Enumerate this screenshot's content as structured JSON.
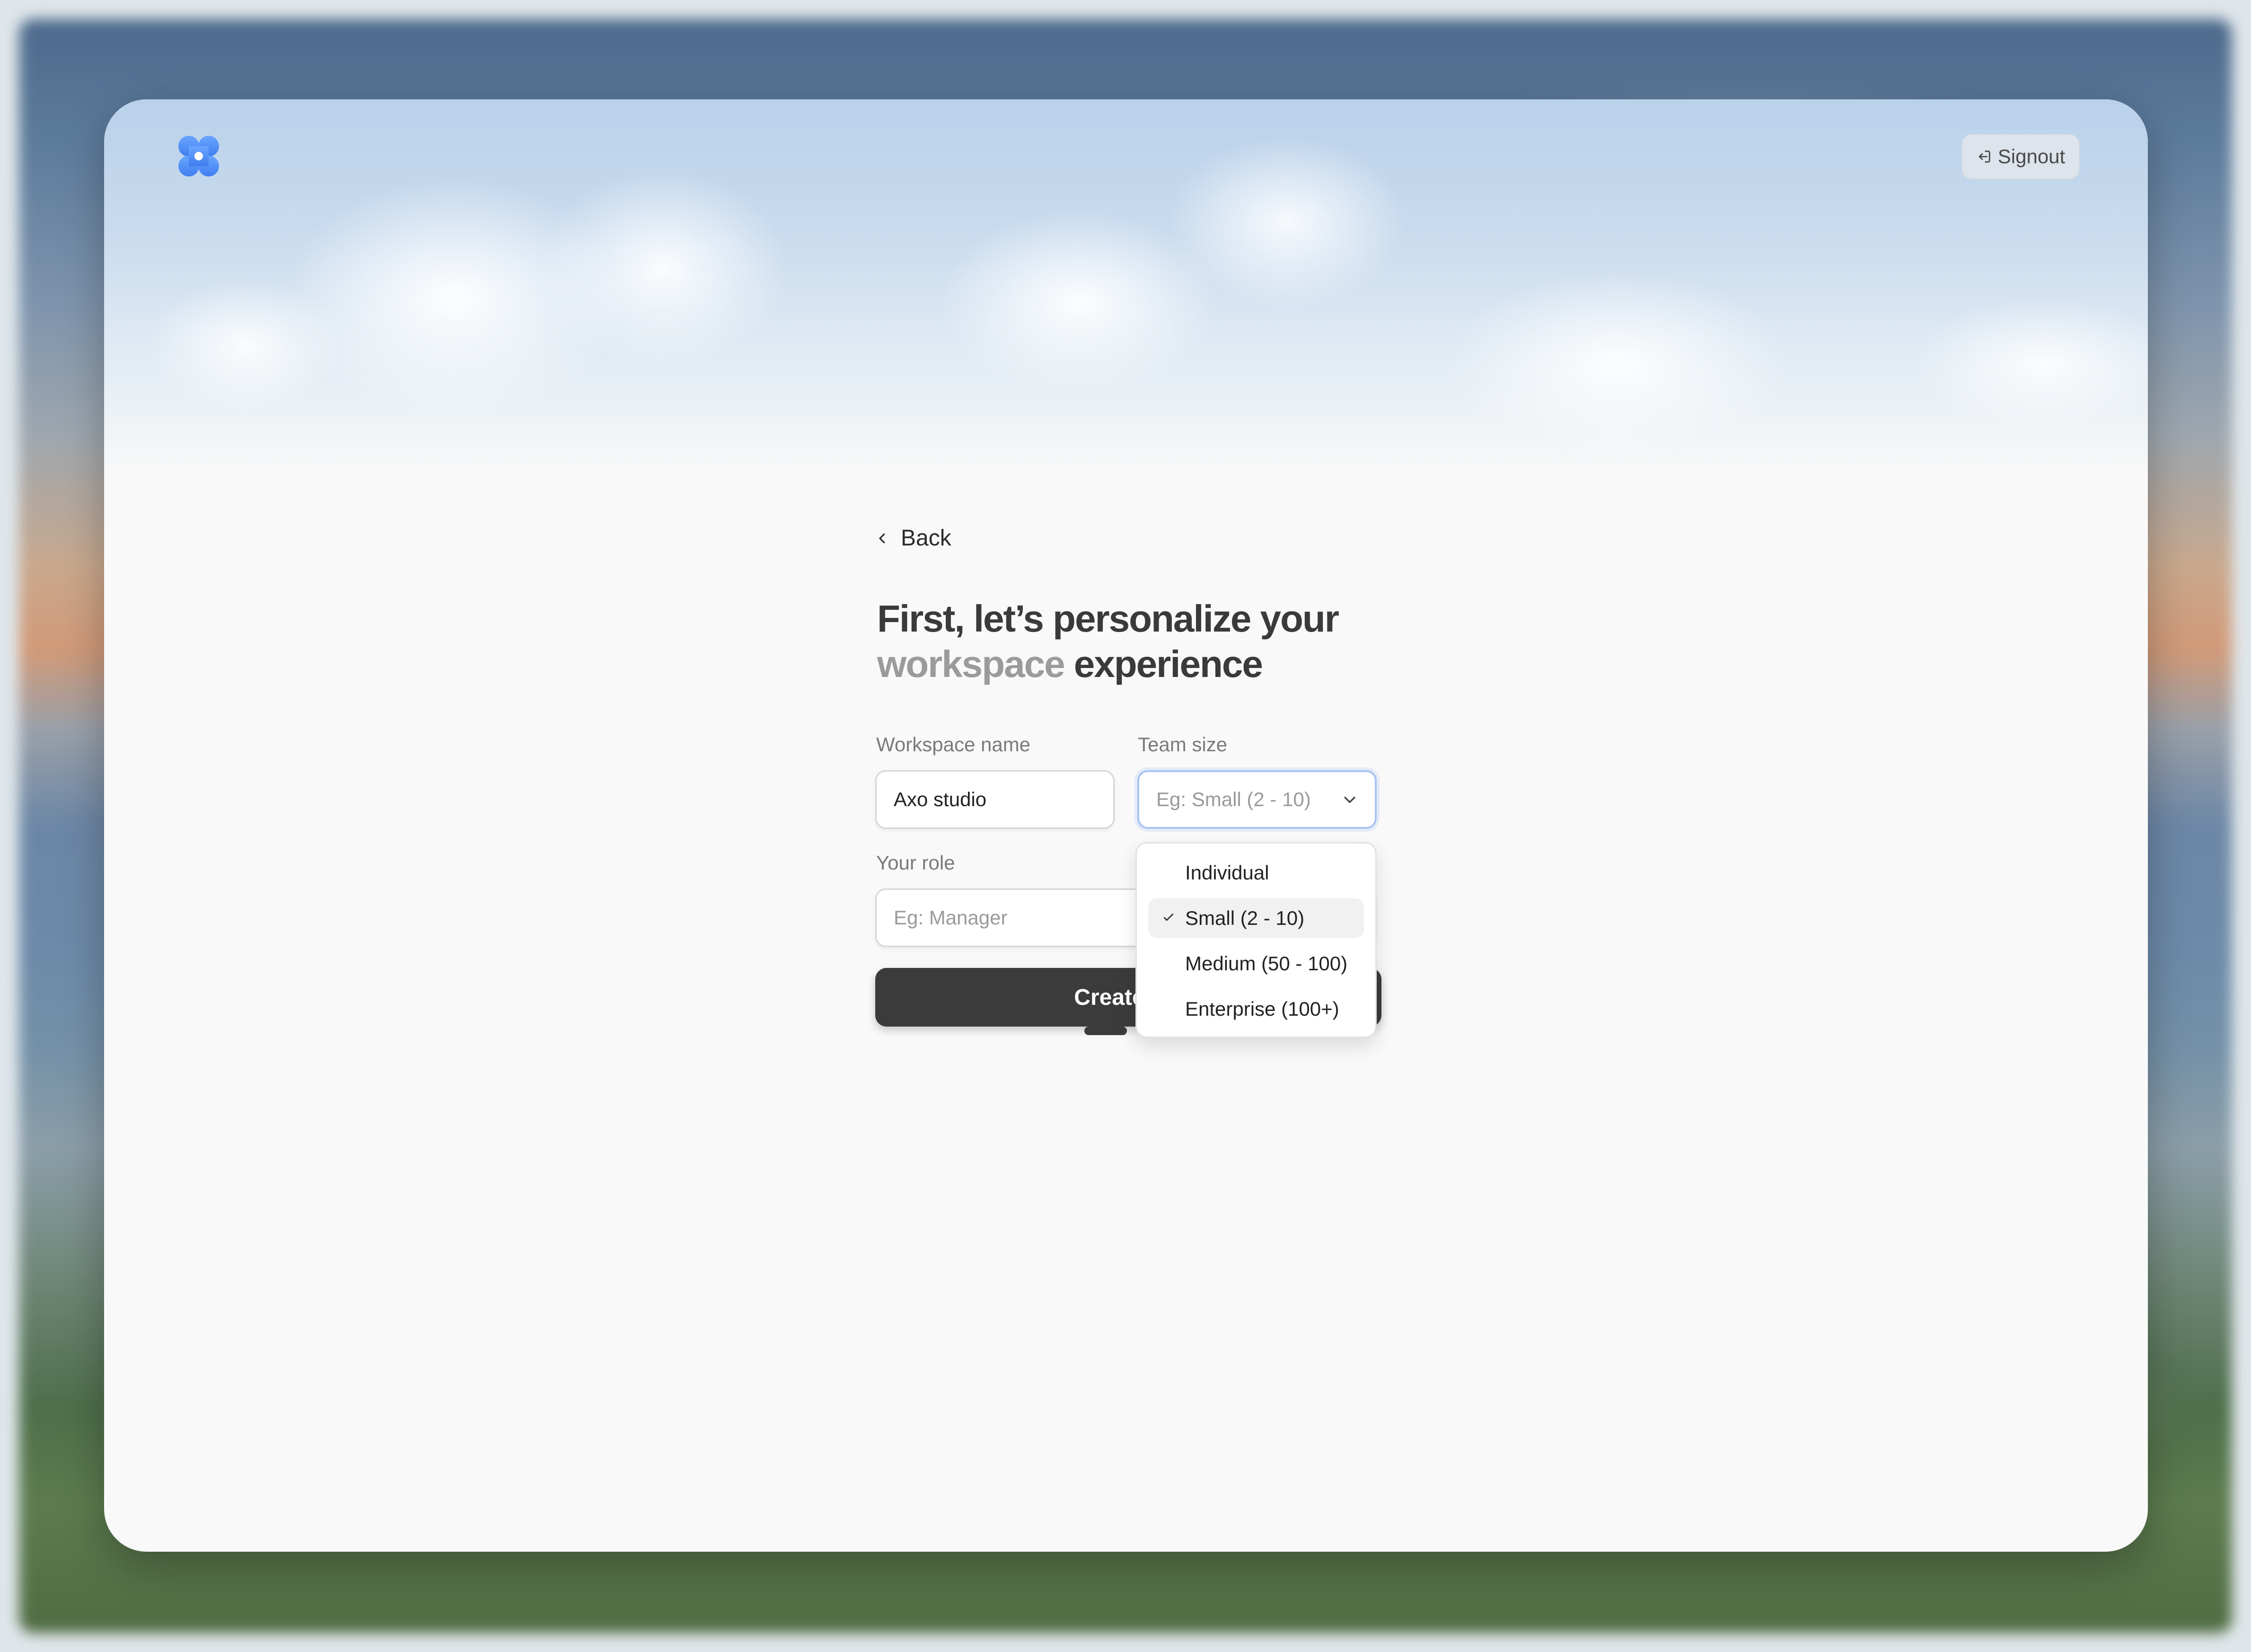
{
  "header": {
    "signout_label": "Signout"
  },
  "form": {
    "back_label": "Back",
    "headline_line1": "First, let’s personalize your",
    "headline_muted": "workspace",
    "headline_rest": " experience",
    "workspace_name": {
      "label": "Workspace name",
      "value": "Axo studio"
    },
    "team_size": {
      "label": "Team size",
      "placeholder": "Eg: Small (2 - 10)"
    },
    "role": {
      "label": "Your role",
      "placeholder": "Eg: Manager"
    },
    "create_button_label": "Create wo"
  },
  "dropdown": {
    "options": [
      {
        "label": "Individual",
        "selected": false
      },
      {
        "label": "Small (2 - 10)",
        "selected": true
      },
      {
        "label": "Medium (50 - 100)",
        "selected": false
      },
      {
        "label": "Enterprise (100+)",
        "selected": false
      }
    ]
  },
  "pagination": {
    "total_steps": 3,
    "current_step": 1
  },
  "colors": {
    "logo_blue": "#4f8ef7",
    "button_dark": "#3b3b3b",
    "focus_ring": "#a9c4f2"
  },
  "icons": {
    "logo": "flower-logo-icon",
    "signout": "signout-icon",
    "back": "chevron-left-icon",
    "select": "chevron-down-icon",
    "check": "check-icon"
  }
}
